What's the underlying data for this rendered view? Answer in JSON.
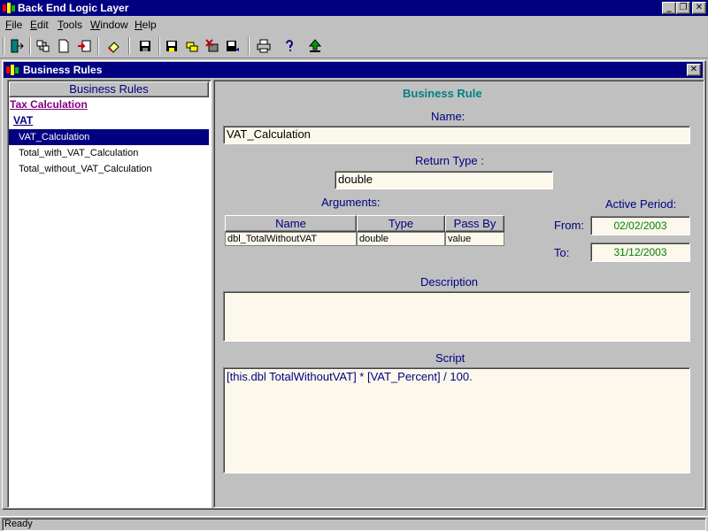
{
  "app": {
    "title": "Back End Logic Layer",
    "caption_buttons": {
      "minimize": "_",
      "restore": "❐",
      "close": "✕"
    }
  },
  "menu": [
    {
      "label": "File",
      "accel": "F"
    },
    {
      "label": "Edit",
      "accel": "E"
    },
    {
      "label": "Tools",
      "accel": "T"
    },
    {
      "label": "Window",
      "accel": "W"
    },
    {
      "label": "Help",
      "accel": "H"
    }
  ],
  "toolbar": {
    "icons": [
      "exit-icon",
      "connect-icon",
      "new-document-icon",
      "import-icon",
      "eraser-icon",
      "save-icon",
      "save-all-icon",
      "copy-icon",
      "delete-icon",
      "save-as-icon",
      "print-icon",
      "help-icon",
      "upload-icon"
    ]
  },
  "child_window": {
    "title": "Business Rules",
    "close": "✕"
  },
  "tree": {
    "header": "Business Rules",
    "category": "Tax Calculation",
    "group": "VAT",
    "items": [
      {
        "label": "VAT_Calculation",
        "selected": true
      },
      {
        "label": "Total_with_VAT_Calculation",
        "selected": false
      },
      {
        "label": "Total_without_VAT_Calculation",
        "selected": false
      }
    ]
  },
  "form": {
    "heading": "Business Rule",
    "name_label": "Name:",
    "name_value": "VAT_Calculation",
    "return_type_label": "Return Type :",
    "return_type_value": "double",
    "arguments_label": "Arguments:",
    "arguments": {
      "columns": [
        "Name",
        "Type",
        "Pass By"
      ],
      "rows": [
        [
          "dbl_TotalWithoutVAT",
          "double",
          "value"
        ]
      ]
    },
    "active_period_label": "Active Period:",
    "from_label": "From:",
    "from_value": "02/02/2003",
    "to_label": "To:",
    "to_value": "31/12/2003",
    "description_label": "Description",
    "description_value": "",
    "script_label": "Script",
    "script_value": "[this.dbl TotalWithoutVAT] * [VAT_Percent] / 100."
  },
  "status": {
    "text": "Ready"
  },
  "colors": {
    "title_bar": "#000080",
    "field_bg": "#fdf8ec",
    "label": "#000080",
    "heading": "#008080",
    "date_text": "#008000",
    "category_link": "#800080"
  }
}
